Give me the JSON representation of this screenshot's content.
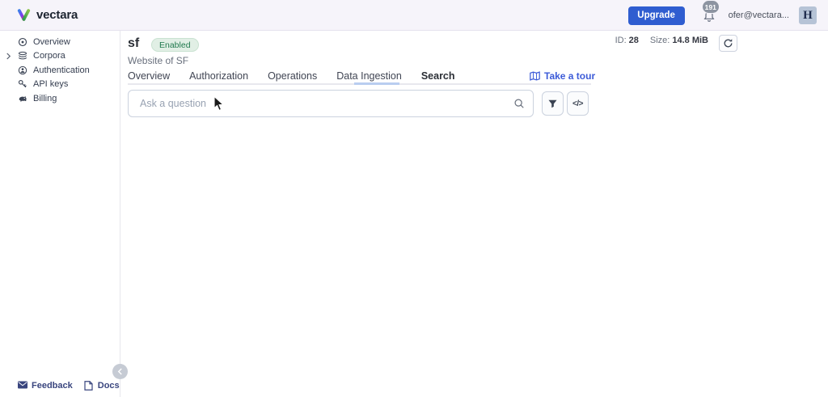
{
  "topbar": {
    "brand": "vectara",
    "upgrade_label": "Upgrade",
    "notification_count": "191",
    "user_email": "ofer@vectara...",
    "avatar_initial": "H"
  },
  "sidebar": {
    "items": [
      {
        "label": "Overview",
        "icon": "overview-icon"
      },
      {
        "label": "Corpora",
        "icon": "corpora-icon",
        "expandable": true
      },
      {
        "label": "Authentication",
        "icon": "authentication-icon"
      },
      {
        "label": "API keys",
        "icon": "key-icon"
      },
      {
        "label": "Billing",
        "icon": "billing-icon"
      }
    ],
    "footer_links": [
      {
        "label": "Feedback",
        "icon": "envelope-icon"
      },
      {
        "label": "Docs",
        "icon": "document-icon"
      }
    ]
  },
  "corpus": {
    "name": "sf",
    "status_badge": "Enabled",
    "description": "Website of SF",
    "id_label": "ID:",
    "id_value": "28",
    "size_label": "Size:",
    "size_value": "14.8 MiB"
  },
  "tabs": {
    "items": [
      "Overview",
      "Authorization",
      "Operations",
      "Data Ingestion",
      "Search"
    ],
    "active": "Search"
  },
  "tour": {
    "label": "Take a tour"
  },
  "search": {
    "placeholder": "Ask a question"
  },
  "icons": {
    "code_glyph": "</>"
  },
  "colors": {
    "upgrade_blue": "#2f5dd0",
    "link_blue": "#3c5bd8",
    "enabled_badge_bg": "#e1efe5",
    "enabled_badge_text": "#20794d",
    "active_tab_underline": "#b9cdf0",
    "topbar_bg": "#f6f4fa"
  }
}
